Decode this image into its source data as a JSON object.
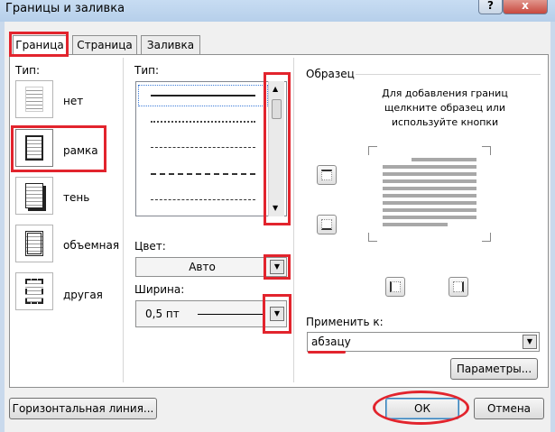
{
  "window": {
    "title": "Границы и заливка",
    "help_label": "?",
    "close_label": "x"
  },
  "tabs": [
    "Граница",
    "Страница",
    "Заливка"
  ],
  "setting": {
    "label": "Тип:",
    "items": [
      "нет",
      "рамка",
      "тень",
      "объемная",
      "другая"
    ],
    "selected": "рамка"
  },
  "style": {
    "label": "Тип:",
    "line_styles": [
      "solid",
      "dotted",
      "dashed",
      "dashed-long",
      "dash-dot"
    ]
  },
  "color": {
    "label": "Цвет:",
    "value": "Авто"
  },
  "width": {
    "label": "Ширина:",
    "value": "0,5 пт"
  },
  "preview": {
    "label": "Образец",
    "hint": "Для добавления границ щелкните образец или используйте кнопки"
  },
  "apply_to": {
    "label": "Применить к:",
    "value": "абзацу"
  },
  "buttons": {
    "options": "Параметры...",
    "horizontal_line": "Горизонтальная линия...",
    "ok": "ОК",
    "cancel": "Отмена"
  },
  "colors": {
    "highlight": "#e2242d",
    "title_bar": "#b9d1ea",
    "close_button": "#c7483e"
  }
}
